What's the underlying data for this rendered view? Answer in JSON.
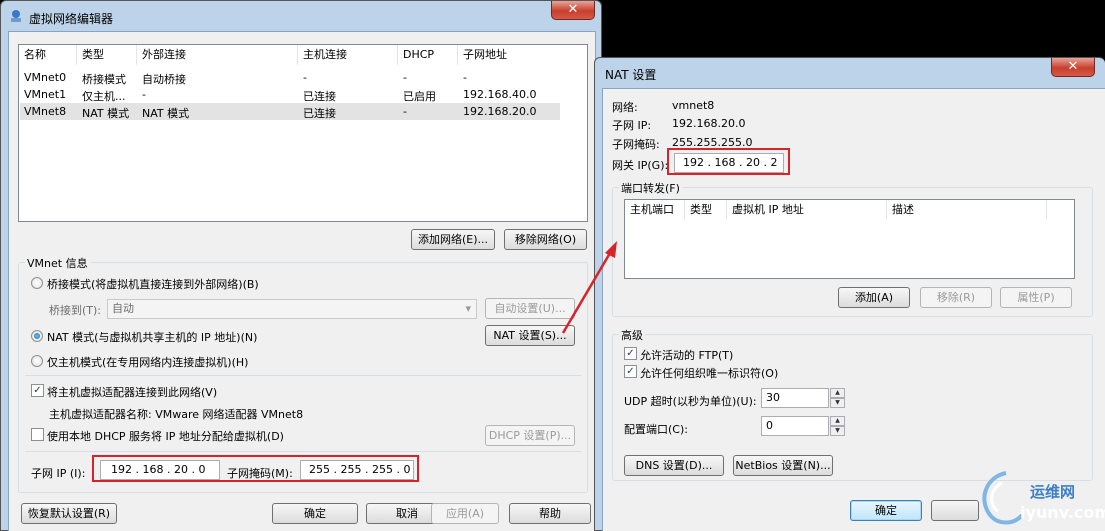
{
  "left_window": {
    "title": "虚拟网络编辑器",
    "columns": [
      "名称",
      "类型",
      "外部连接",
      "主机连接",
      "DHCP",
      "子网地址"
    ],
    "rows": [
      [
        "VMnet0",
        "桥接模式",
        "自动桥接",
        "-",
        "-",
        "-"
      ],
      [
        "VMnet1",
        "仅主机...",
        "-",
        "已连接",
        "已启用",
        "192.168.40.0"
      ],
      [
        "VMnet8",
        "NAT 模式",
        "NAT 模式",
        "已连接",
        "-",
        "192.168.20.0"
      ]
    ],
    "add_network_btn": "添加网络(E)...",
    "remove_network_btn": "移除网络(O)",
    "vmnet_info_title": "VMnet 信息",
    "bridge_radio": "桥接模式(将虚拟机直接连接到外部网络)(B)",
    "bridge_to_label": "桥接到(T):",
    "bridge_to_value": "自动",
    "auto_settings_btn": "自动设置(U)...",
    "nat_radio": "NAT 模式(与虚拟机共享主机的 IP 地址)(N)",
    "nat_settings_btn": "NAT 设置(S)...",
    "host_only_radio": "仅主机模式(在专用网络内连接虚拟机)(H)",
    "connect_adapter_check": "将主机虚拟适配器连接到此网络(V)",
    "adapter_name": "主机虚拟适配器名称: VMware 网络适配器 VMnet8",
    "dhcp_check": "使用本地 DHCP 服务将 IP 地址分配给虚拟机(D)",
    "dhcp_settings_btn": "DHCP 设置(P)...",
    "subnet_ip_label": "子网 IP (I):",
    "subnet_ip_value": "192 . 168 . 20 .  0",
    "subnet_mask_label": "子网掩码(M):",
    "subnet_mask_value": "255 . 255 . 255 .  0",
    "restore_btn": "恢复默认设置(R)",
    "ok_btn": "确定",
    "cancel_btn": "取消",
    "apply_btn": "应用(A)",
    "help_btn": "帮助"
  },
  "nat_window": {
    "title": "NAT 设置",
    "network_label": "网络:",
    "network_value": "vmnet8",
    "subnet_ip_label": "子网 IP:",
    "subnet_ip_value": "192.168.20.0",
    "subnet_mask_label": "子网掩码:",
    "subnet_mask_value": "255.255.255.0",
    "gateway_label": "网关 IP(G):",
    "gateway_value": "192 . 168 . 20  .  2",
    "port_forward_title": "端口转发(F)",
    "pf_columns": [
      "主机端口",
      "类型",
      "虚拟机 IP 地址",
      "描述"
    ],
    "add_btn": "添加(A)",
    "remove_btn": "移除(R)",
    "props_btn": "属性(P)",
    "advanced_title": "高级",
    "ftp_check": "允许活动的 FTP(T)",
    "oui_check": "允许任何组织唯一标识符(O)",
    "udp_label": "UDP 超时(以秒为单位)(U):",
    "udp_value": "30",
    "config_port_label": "配置端口(C):",
    "config_port_value": "0",
    "dns_btn": "DNS 设置(D)...",
    "netbios_btn": "NetBios 设置(N)...",
    "ok_btn": "确定"
  },
  "watermark": {
    "cn": "运维网",
    "en": "iyunv.com"
  },
  "colors": {
    "highlight_red": "#d9232b",
    "title_bar": "#bdd3ea",
    "close_button": "#c7402b"
  }
}
